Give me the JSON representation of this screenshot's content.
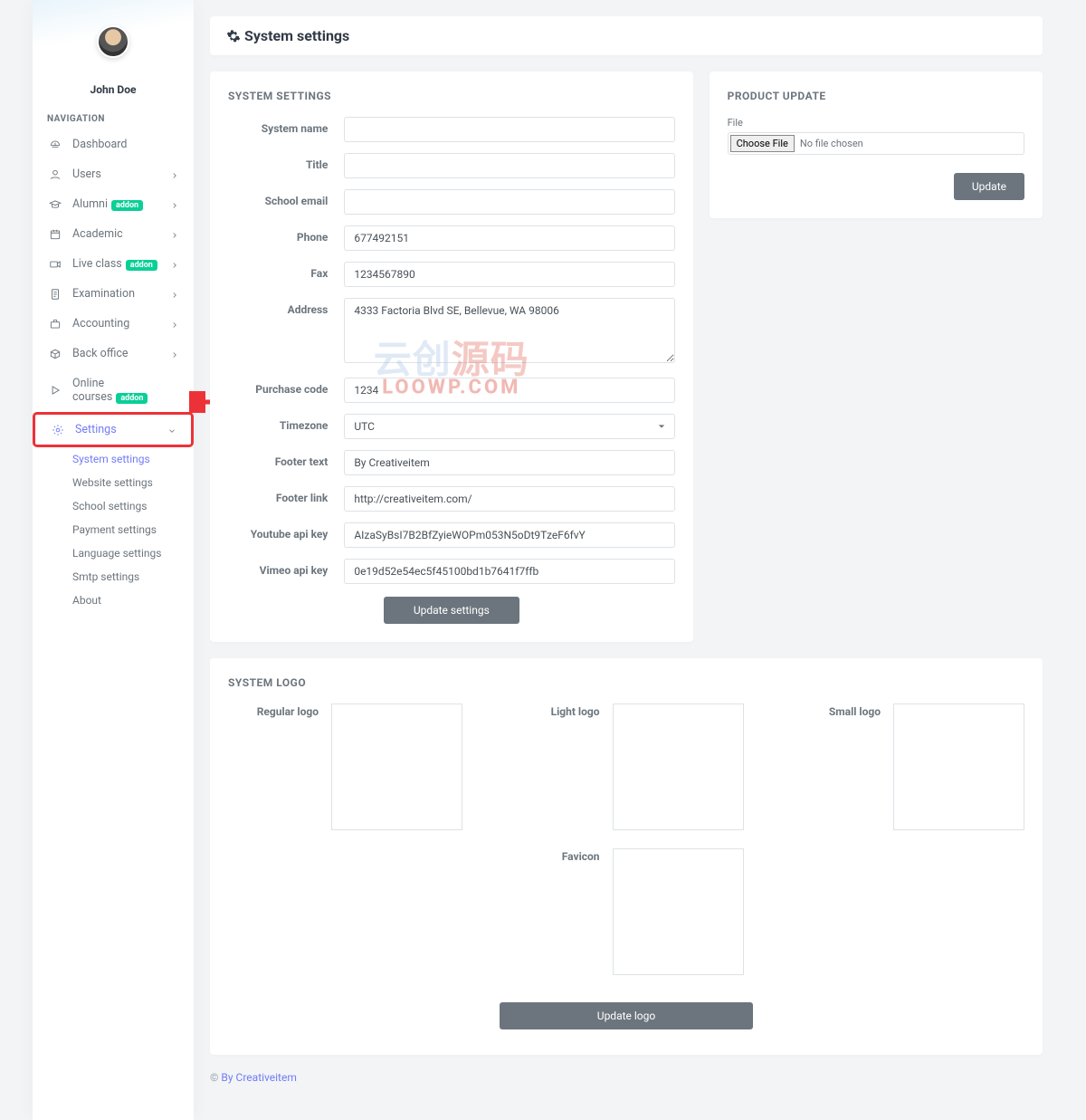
{
  "user": {
    "name": "John Doe"
  },
  "sidebar": {
    "section": "NAVIGATION",
    "items": [
      {
        "label": "Dashboard"
      },
      {
        "label": "Users"
      },
      {
        "label": "Alumni",
        "addon": "addon"
      },
      {
        "label": "Academic"
      },
      {
        "label": "Live class",
        "addon": "addon"
      },
      {
        "label": "Examination"
      },
      {
        "label": "Accounting"
      },
      {
        "label": "Back office"
      },
      {
        "label": "Online courses",
        "addon": "addon"
      },
      {
        "label": "Settings"
      }
    ],
    "sub": [
      "System settings",
      "Website settings",
      "School settings",
      "Payment settings",
      "Language settings",
      "Smtp settings",
      "About"
    ]
  },
  "page": {
    "title": "System settings"
  },
  "settings": {
    "title": "SYSTEM SETTINGS",
    "labels": {
      "system_name": "System name",
      "title": "Title",
      "school_email": "School email",
      "phone": "Phone",
      "fax": "Fax",
      "address": "Address",
      "purchase_code": "Purchase code",
      "timezone": "Timezone",
      "footer_text": "Footer text",
      "footer_link": "Footer link",
      "youtube": "Youtube api key",
      "vimeo": "Vimeo api key"
    },
    "values": {
      "system_name": "",
      "title": "",
      "school_email": "",
      "phone": "677492151",
      "fax": "1234567890",
      "address": "4333 Factoria Blvd SE, Bellevue, WA 98006",
      "purchase_code": "1234",
      "timezone": "UTC",
      "footer_text": "By Creativeitem",
      "footer_link": "http://creativeitem.com/",
      "youtube": "AIzaSyBsI7B2BfZyieWOPm053N5oDt9TzeF6fvY",
      "vimeo": "0e19d52e54ec5f45100bd1b7641f7ffb"
    },
    "submit": "Update settings"
  },
  "product_update": {
    "title": "PRODUCT UPDATE",
    "file_label": "File",
    "choose": "Choose File",
    "no_file": "No file chosen",
    "submit": "Update"
  },
  "logo": {
    "title": "SYSTEM LOGO",
    "regular": "Regular logo",
    "light": "Light logo",
    "small": "Small logo",
    "favicon": "Favicon",
    "submit": "Update logo"
  },
  "footer": {
    "copy": "© ",
    "link": "By Creativeitem"
  },
  "watermark": {
    "line1a": "云创",
    "line1b": "源码",
    "line2": "LOOWP.COM"
  }
}
